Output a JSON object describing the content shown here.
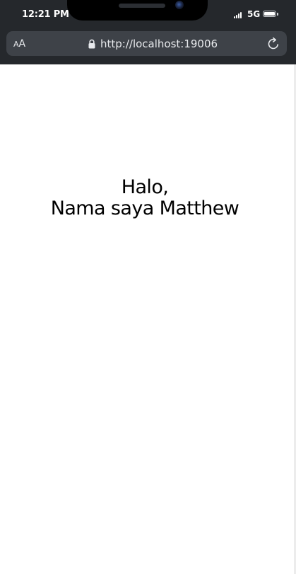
{
  "status_bar": {
    "time": "12:21 PM",
    "network": "5G",
    "battery_level": 1.0
  },
  "browser": {
    "text_size_label_small": "A",
    "text_size_label_large": "A",
    "url": "http://localhost:19006",
    "icons": {
      "lock": "lock-icon",
      "reload": "reload-icon",
      "signal": "signal-icon",
      "battery": "battery-icon"
    },
    "colors": {
      "chrome": "#25282c",
      "address_bar": "#3e4248"
    }
  },
  "content": {
    "line1": "Halo,",
    "line2": "Nama saya Matthew"
  }
}
